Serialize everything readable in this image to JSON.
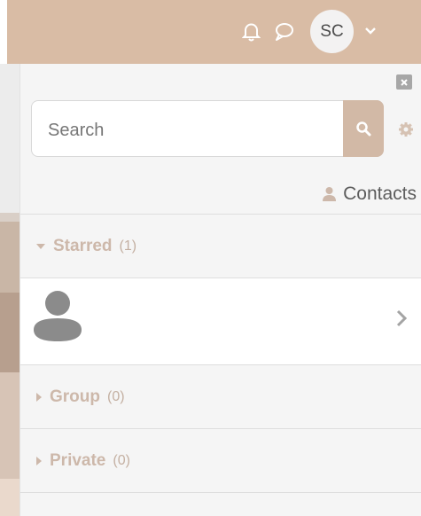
{
  "navbar": {
    "avatar_initials": "SC",
    "icons": [
      "bell-icon",
      "chat-icon",
      "chevron-down-icon"
    ],
    "color": "#d9bca5"
  },
  "drawer": {
    "search": {
      "placeholder": "Search"
    },
    "contacts_label": "Contacts",
    "sections": {
      "starred": {
        "label": "Starred",
        "count": "(1)"
      },
      "group": {
        "label": "Group",
        "count": "(0)"
      },
      "private": {
        "label": "Private",
        "count": "(0)"
      }
    }
  }
}
